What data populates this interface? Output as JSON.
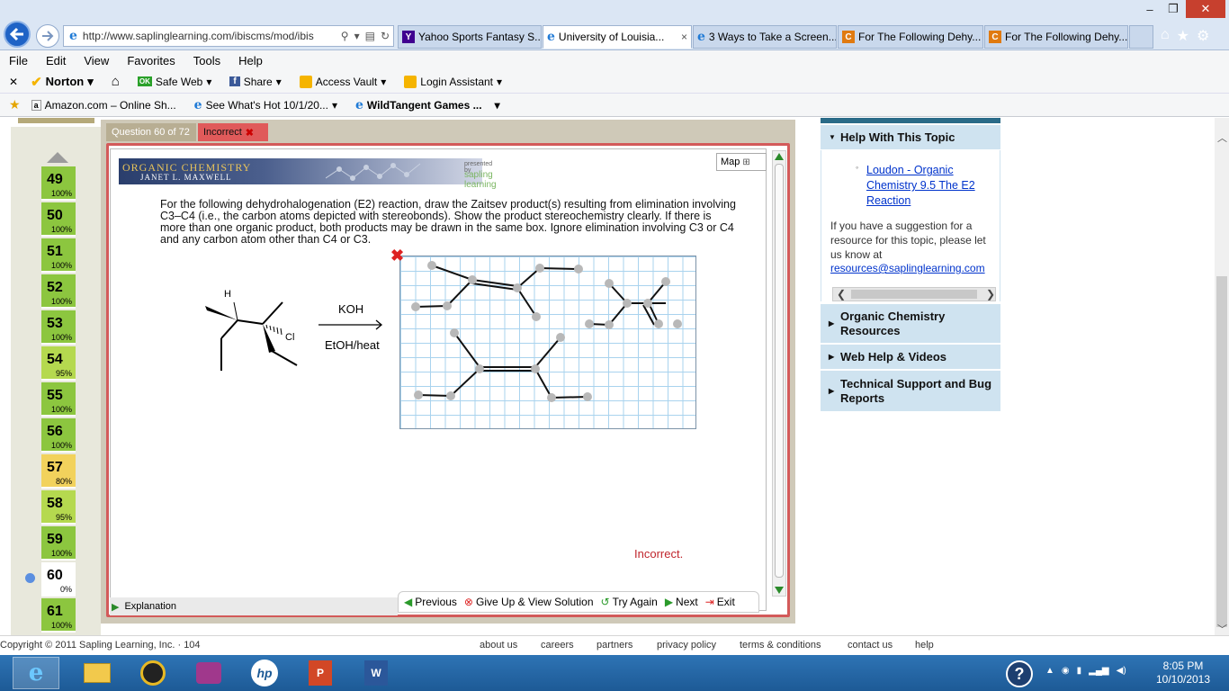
{
  "browser": {
    "url": "http://www.saplinglearning.com/ibiscms/mod/ibis",
    "tabs": [
      {
        "label": "Yahoo Sports Fantasy S...",
        "icon": "Y",
        "color": "#400090"
      },
      {
        "label": "University of Louisia...",
        "icon": "e",
        "color": "#1f7ad6",
        "active": true
      },
      {
        "label": "3 Ways to Take a Screen...",
        "icon": "e",
        "color": "#1f7ad6"
      },
      {
        "label": "For The Following Dehy...",
        "icon": "C",
        "color": "#e07a10"
      },
      {
        "label": "For The Following Dehy...",
        "icon": "C",
        "color": "#e07a10"
      }
    ],
    "close_tab_glyph": "×"
  },
  "menubar": [
    "File",
    "Edit",
    "View",
    "Favorites",
    "Tools",
    "Help"
  ],
  "toolbar": {
    "norton": "Norton",
    "safe_web": "Safe Web",
    "share": "Share",
    "access_vault": "Access Vault",
    "login_assistant": "Login Assistant"
  },
  "favorites": [
    {
      "label": "Amazon.com – Online Sh..."
    },
    {
      "label": "See What's Hot 10/1/20..."
    },
    {
      "label": "WildTangent Games ..."
    }
  ],
  "sidebar": {
    "questions": [
      {
        "num": "49",
        "pct": "100%",
        "color": "#8cc63f"
      },
      {
        "num": "50",
        "pct": "100%",
        "color": "#8cc63f"
      },
      {
        "num": "51",
        "pct": "100%",
        "color": "#8cc63f"
      },
      {
        "num": "52",
        "pct": "100%",
        "color": "#8cc63f"
      },
      {
        "num": "53",
        "pct": "100%",
        "color": "#8cc63f"
      },
      {
        "num": "54",
        "pct": "95%",
        "color": "#b5d94f"
      },
      {
        "num": "55",
        "pct": "100%",
        "color": "#8cc63f"
      },
      {
        "num": "56",
        "pct": "100%",
        "color": "#8cc63f"
      },
      {
        "num": "57",
        "pct": "80%",
        "color": "#f2d25c"
      },
      {
        "num": "58",
        "pct": "95%",
        "color": "#b5d94f"
      },
      {
        "num": "59",
        "pct": "100%",
        "color": "#8cc63f"
      },
      {
        "num": "60",
        "pct": "0%",
        "color": "#ffffff"
      },
      {
        "num": "61",
        "pct": "100%",
        "color": "#8cc63f"
      }
    ]
  },
  "question": {
    "tab_label": "Question 60 of 72",
    "status_label": "Incorrect",
    "banner_title": "Organic Chemistry",
    "banner_author": "Janet L. Maxwell",
    "banner_presented": "presented by",
    "banner_brand": "sapling learning",
    "map_label": "Map",
    "text": "For the following dehydrohalogenation (E2) reaction, draw the Zaitsev product(s) resulting from elimination involving C3–C4 (i.e., the carbon atoms depicted with stereobonds). Show the product stereochemistry clearly. If there is more than one organic product, both products may be drawn in the same box. Ignore elimination involving C3 or C4 and any carbon atom other than C4 or C3.",
    "reagent_top": "KOH",
    "reagent_bottom": "EtOH/heat",
    "atom_h": "H",
    "atom_cl": "Cl",
    "feedback": "Incorrect.",
    "explanation_label": "Explanation",
    "nav": {
      "previous": "Previous",
      "give_up": "Give Up & View Solution",
      "try_again": "Try Again",
      "next": "Next",
      "exit": "Exit"
    }
  },
  "right_panel": {
    "help_header": "Help With This Topic",
    "link": "Loudon - Organic Chemistry 9.5 The E2 Reaction",
    "suggestion": "If you have a suggestion for a resource for this topic, please let us know at",
    "email": "resources@saplinglearning.com",
    "sections": [
      "Organic Chemistry Resources",
      "Web Help & Videos",
      "Technical Support and Bug Reports"
    ]
  },
  "footer": {
    "copyright": "Copyright © 2011 Sapling Learning, Inc. · 104",
    "links": [
      "about us",
      "careers",
      "partners",
      "privacy policy",
      "terms & conditions",
      "contact us",
      "help"
    ]
  },
  "taskbar": {
    "time": "8:05 PM",
    "date": "10/10/2013"
  }
}
